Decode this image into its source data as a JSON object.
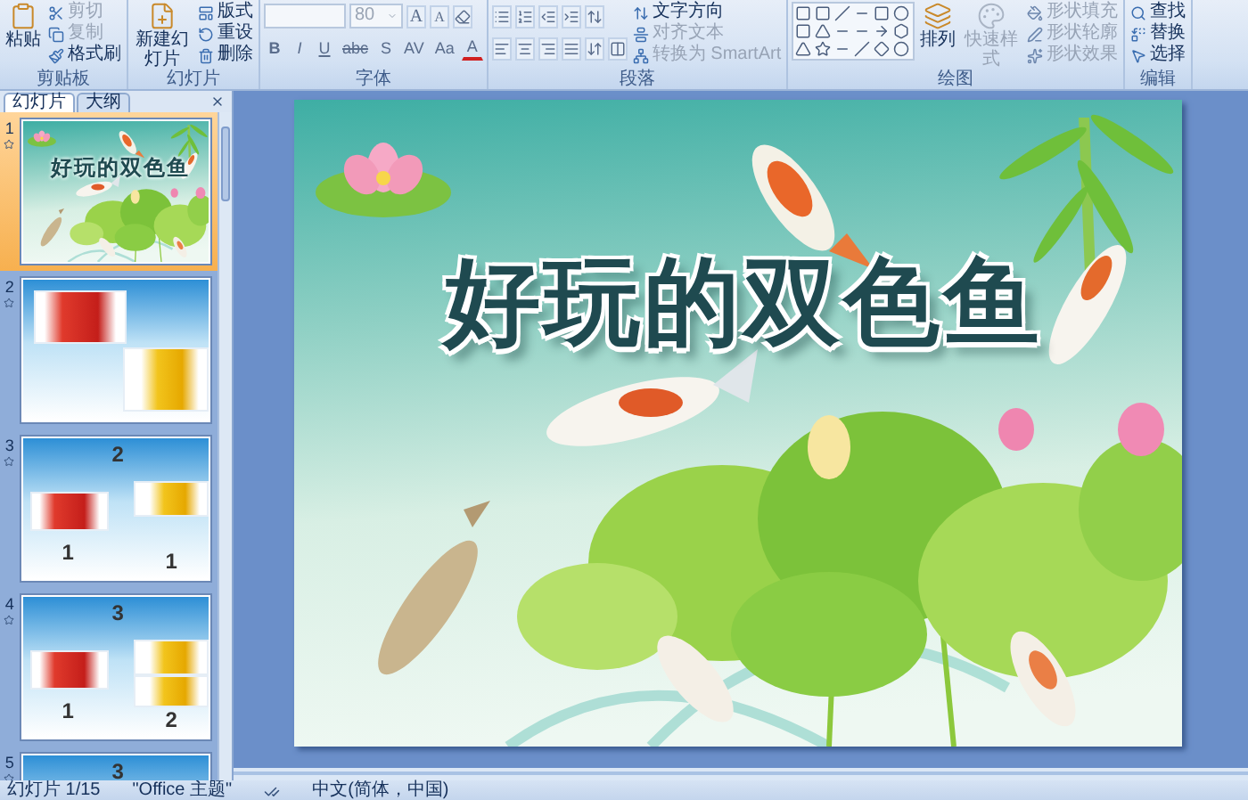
{
  "ribbon": {
    "groups": [
      {
        "label": "剪贴板",
        "kind": "buttons",
        "large": [
          {
            "label": "粘贴",
            "disabled": false
          }
        ],
        "small": [
          {
            "label": "剪切",
            "disabled": true
          },
          {
            "label": "复制",
            "disabled": true
          },
          {
            "label": "格式刷",
            "disabled": false
          }
        ]
      },
      {
        "label": "幻灯片",
        "kind": "buttons",
        "large": [
          {
            "label": "新建幻灯片",
            "disabled": false
          }
        ],
        "small": [
          {
            "label": "版式",
            "disabled": false
          },
          {
            "label": "重设",
            "disabled": false
          },
          {
            "label": "删除",
            "disabled": false
          }
        ]
      },
      {
        "label": "字体",
        "kind": "font",
        "font_size": "80",
        "buttons": [
          "A",
          "A",
          "B",
          "I",
          "U",
          "abc",
          "S",
          "AV",
          "Aa",
          "A"
        ]
      },
      {
        "label": "段落",
        "kind": "paragraph",
        "small": [
          {
            "label": "文字方向",
            "disabled": false
          },
          {
            "label": "对齐文本",
            "disabled": true
          },
          {
            "label": "转换为 SmartArt",
            "disabled": true
          }
        ]
      },
      {
        "label": "绘图",
        "kind": "drawing",
        "large": [
          {
            "label": "排列",
            "disabled": false
          },
          {
            "label": "快速样式",
            "disabled": true
          }
        ],
        "small": [
          {
            "label": "形状填充",
            "disabled": true
          },
          {
            "label": "形状轮廓",
            "disabled": true
          },
          {
            "label": "形状效果",
            "disabled": true
          }
        ]
      },
      {
        "label": "编辑",
        "kind": "buttons",
        "small": [
          {
            "label": "查找",
            "disabled": false
          },
          {
            "label": "替换",
            "disabled": false
          },
          {
            "label": "选择",
            "disabled": false
          }
        ]
      }
    ]
  },
  "slide_panel": {
    "tabs": [
      {
        "label": "幻灯片",
        "selected": true
      },
      {
        "label": "大纲",
        "selected": false
      }
    ],
    "slides": [
      {
        "number": "1",
        "selected": true,
        "kind": "title",
        "title": "好玩的双色鱼"
      },
      {
        "number": "2",
        "selected": false,
        "kind": "photos",
        "photos": [
          {
            "kind": "red-fish"
          },
          {
            "kind": "yellow-fish"
          }
        ]
      },
      {
        "number": "3",
        "selected": false,
        "kind": "diagram",
        "photos": [
          {
            "kind": "red-fish"
          },
          {
            "kind": "yellow-fish"
          }
        ],
        "labels": [
          "2",
          "1",
          "1"
        ]
      },
      {
        "number": "4",
        "selected": false,
        "kind": "diagram",
        "photos": [
          {
            "kind": "red-fish"
          },
          {
            "kind": "yellow-fish"
          },
          {
            "kind": "yellow-fish"
          }
        ],
        "labels": [
          "3",
          "1",
          "2"
        ]
      },
      {
        "number": "5",
        "selected": false,
        "kind": "diagram",
        "labels": [
          "3"
        ]
      }
    ]
  },
  "slide": {
    "title": "好玩的双色鱼"
  },
  "status_bar": {
    "slide_counter": "幻灯片 1/15",
    "theme": "\"Office 主题\"",
    "language": "中文(简体，中国)"
  }
}
